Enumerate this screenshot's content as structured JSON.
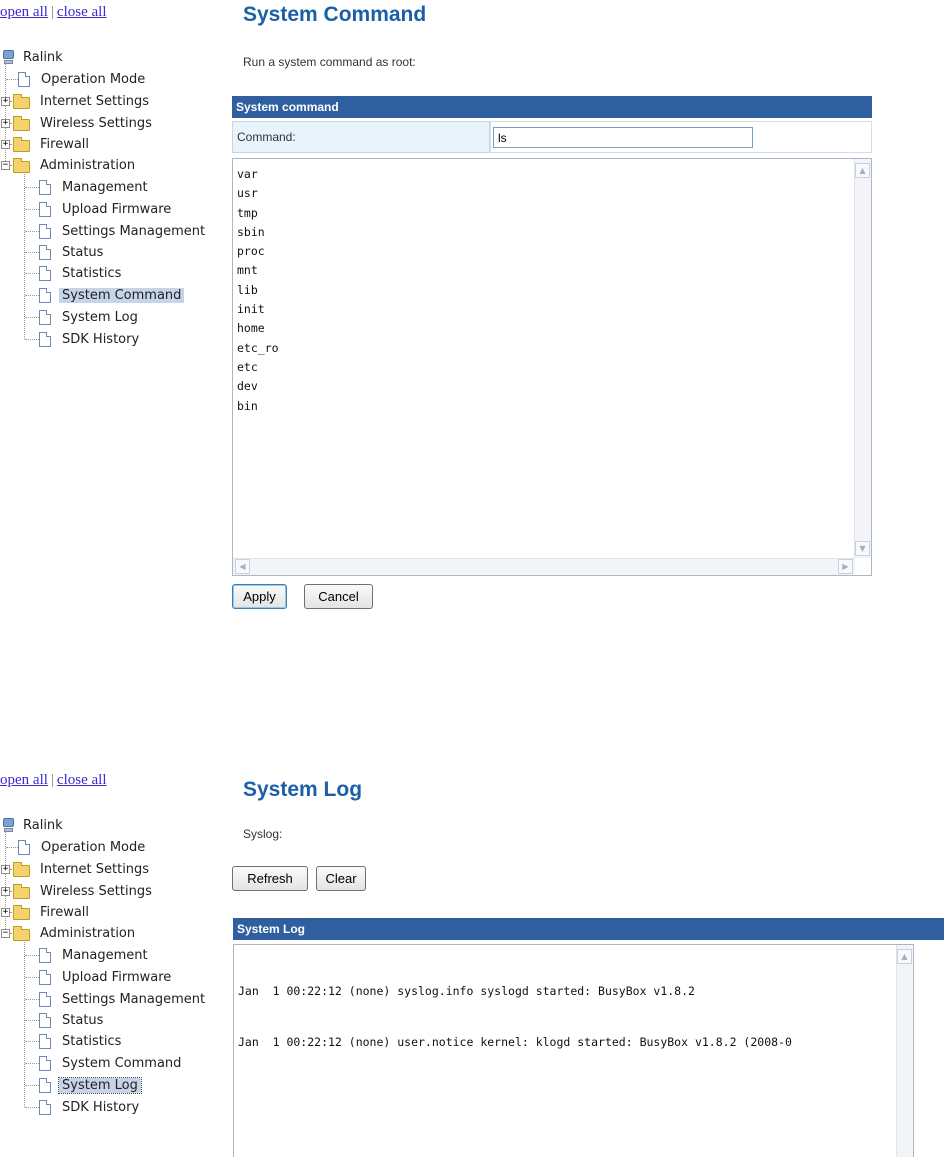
{
  "tree": {
    "open_all": "open all",
    "close_all": "close all",
    "sep": "|",
    "root": "Ralink",
    "items": [
      "Operation Mode",
      "Internet Settings",
      "Wireless Settings",
      "Firewall",
      "Administration"
    ],
    "admin_items": [
      "Management",
      "Upload Firmware",
      "Settings Management",
      "Status",
      "Statistics",
      "System Command",
      "System Log",
      "SDK History"
    ]
  },
  "system_command": {
    "title": "System Command",
    "description": "Run a system command as root:",
    "table_header": "System command",
    "command_label": "Command:",
    "command_value": "ls",
    "output": [
      "var",
      "usr",
      "tmp",
      "sbin",
      "proc",
      "mnt",
      "lib",
      "init",
      "home",
      "etc_ro",
      "etc",
      "dev",
      "bin"
    ],
    "apply": "Apply",
    "cancel": "Cancel"
  },
  "system_log": {
    "title": "System Log",
    "description": "Syslog:",
    "refresh": "Refresh",
    "clear": "Clear",
    "table_header": "System Log",
    "lines": [
      "Jan  1 00:22:12 (none) syslog.info syslogd started: BusyBox v1.8.2",
      "Jan  1 00:22:12 (none) user.notice kernel: klogd started: BusyBox v1.8.2 (2008-0"
    ]
  },
  "colors": {
    "title_blue": "#1b5fa8",
    "header_blue": "#2f5f9e",
    "selection": "#c5d4e8",
    "link": "#3a2bd1"
  }
}
